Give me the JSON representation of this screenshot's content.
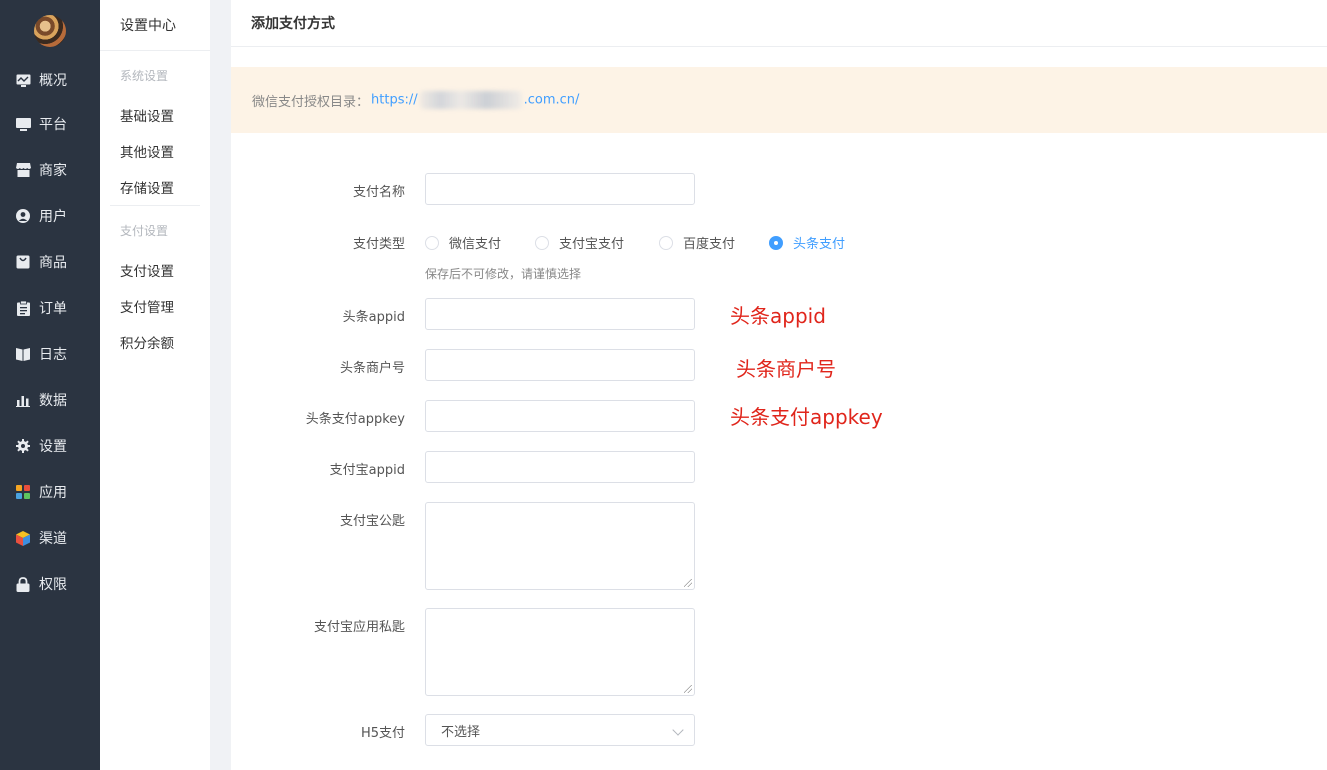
{
  "nav": {
    "items": [
      {
        "label": "概况",
        "icon": "dashboard-icon"
      },
      {
        "label": "平台",
        "icon": "monitor-icon"
      },
      {
        "label": "商家",
        "icon": "store-icon"
      },
      {
        "label": "用户",
        "icon": "user-icon"
      },
      {
        "label": "商品",
        "icon": "bag-icon"
      },
      {
        "label": "订单",
        "icon": "clipboard-icon"
      },
      {
        "label": "日志",
        "icon": "book-icon"
      },
      {
        "label": "数据",
        "icon": "bar-chart-icon"
      },
      {
        "label": "设置",
        "icon": "gear-icon"
      },
      {
        "label": "应用",
        "icon": "apps-grid-icon"
      },
      {
        "label": "渠道",
        "icon": "cube-icon"
      },
      {
        "label": "权限",
        "icon": "lock-icon"
      }
    ]
  },
  "submenu": {
    "title": "设置中心",
    "system_group": "系统设置",
    "system_items": [
      "基础设置",
      "其他设置",
      "存储设置"
    ],
    "pay_group": "支付设置",
    "pay_items": [
      "支付设置",
      "支付管理",
      "积分余额"
    ]
  },
  "page": {
    "title": "添加支付方式",
    "notice_label": "微信支付授权目录：",
    "notice_link_prefix": "https://",
    "notice_link_suffix": ".com.cn/"
  },
  "form": {
    "pay_name_label": "支付名称",
    "pay_type_label": "支付类型",
    "pay_type_options": [
      "微信支付",
      "支付宝支付",
      "百度支付",
      "头条支付"
    ],
    "pay_type_selected": "头条支付",
    "pay_type_hint": "保存后不可修改，请谨慎选择",
    "toutiao_appid_label": "头条appid",
    "toutiao_merchant_label": "头条商户号",
    "toutiao_appkey_label": "头条支付appkey",
    "alipay_appid_label": "支付宝appid",
    "alipay_pubkey_label": "支付宝公匙",
    "alipay_privkey_label": "支付宝应用私匙",
    "h5_label": "H5支付",
    "h5_value": "不选择"
  },
  "annotations": {
    "appid": "头条appid",
    "merchant": "头条商户号",
    "appkey": "头条支付appkey"
  },
  "colors": {
    "nav_bg": "#2b3441",
    "accent": "#409eff",
    "notice_bg": "#fdf3e6",
    "annotation": "#e0251b"
  }
}
